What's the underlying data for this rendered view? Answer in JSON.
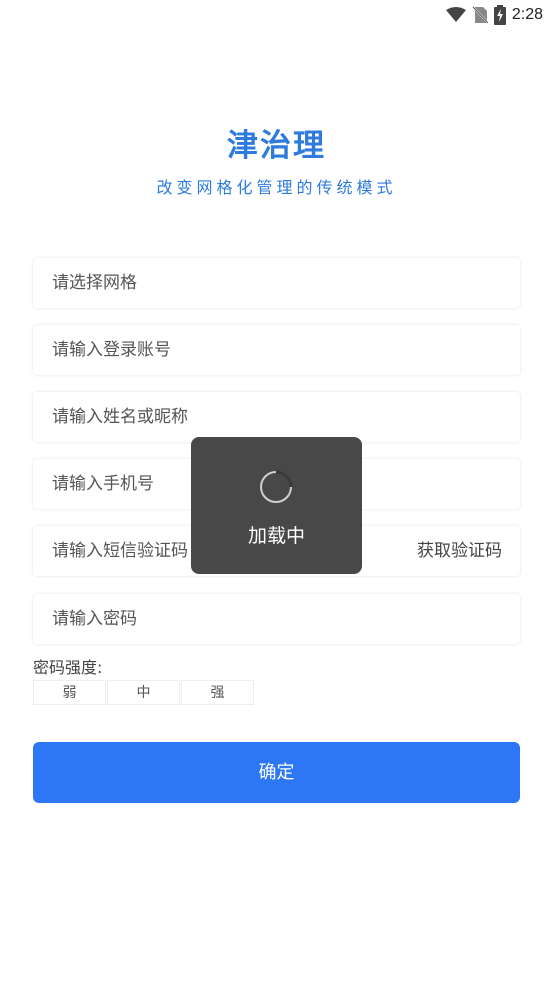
{
  "status_bar": {
    "time": "2:28",
    "icons": [
      "wifi-icon",
      "no-sim-icon",
      "battery-charging-icon"
    ]
  },
  "header": {
    "title": "津治理",
    "subtitle": "改变网格化管理的传统模式"
  },
  "form": {
    "grid_placeholder": "请选择网格",
    "account_placeholder": "请输入登录账号",
    "name_placeholder": "请输入姓名或昵称",
    "phone_placeholder": "请输入手机号",
    "sms_placeholder": "请输入短信验证码",
    "get_code_label": "获取验证码",
    "password_placeholder": "请输入密码",
    "strength_label": "密码强度:",
    "strength_levels": [
      "弱",
      "中",
      "强"
    ],
    "confirm_label": "确定"
  },
  "loading": {
    "text": "加载中"
  },
  "colors": {
    "brand": "#2f7bdc",
    "button": "#2d76f6",
    "toast_bg": "#3a3a3a"
  }
}
